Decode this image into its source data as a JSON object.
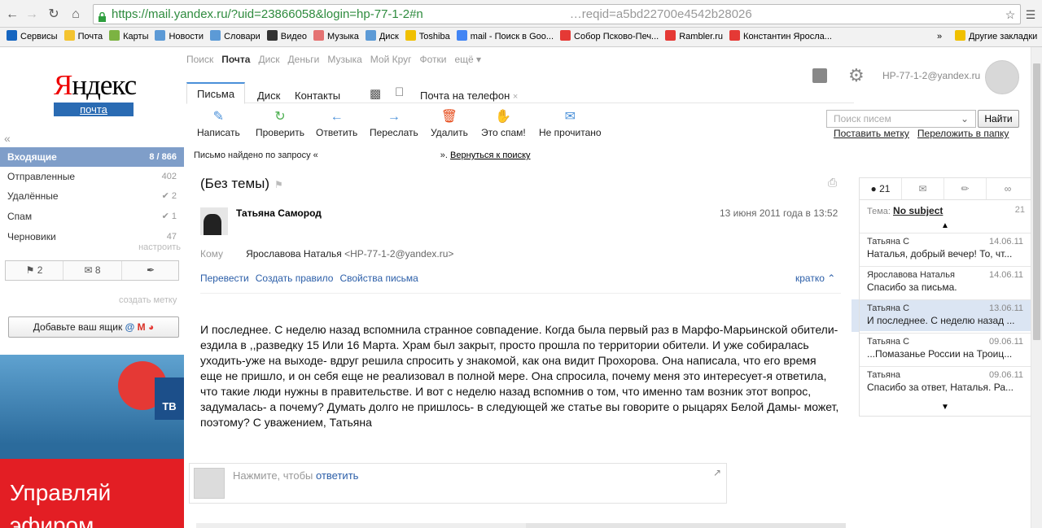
{
  "browser": {
    "url_text": "https://mail.yandex.ru/?uid=23866058&login=hp-77-1-2#n",
    "url_tail": "…reqid=a5bd22700e4542b28026",
    "bookmarks": [
      {
        "label": "Сервисы",
        "color": "#1565c0"
      },
      {
        "label": "Почта",
        "color": "#f4c430"
      },
      {
        "label": "Карты",
        "color": "#7cb342"
      },
      {
        "label": "Новости",
        "color": "#5c9ad6"
      },
      {
        "label": "Словари",
        "color": "#5c9ad6"
      },
      {
        "label": "Видео",
        "color": "#333333"
      },
      {
        "label": "Музыка",
        "color": "#e57373"
      },
      {
        "label": "Диск",
        "color": "#5c9ad6"
      },
      {
        "label": "Toshiba",
        "color": "#f0c000"
      },
      {
        "label": "mail - Поиск в Goo...",
        "color": "#4285f4"
      },
      {
        "label": "Собор Псково-Печ...",
        "color": "#e53935"
      },
      {
        "label": "Rambler.ru",
        "color": "#e53935"
      },
      {
        "label": "Константин Яросла...",
        "color": "#e53935"
      }
    ],
    "more": "»",
    "other_bookmarks": "Другие закладки"
  },
  "topnav": [
    "Поиск",
    "Почта",
    "Диск",
    "Деньги",
    "Музыка",
    "Мой Круг",
    "Фотки",
    "ещё ▾"
  ],
  "logo": {
    "ya_red": "Я",
    "ya_rest": "ндекс",
    "pochta": "почта"
  },
  "user_email": "HP-77-1-2@yandex.ru",
  "folders": [
    {
      "label": "Входящие",
      "count": "8 / 866"
    },
    {
      "label": "Отправленные",
      "count": "402"
    },
    {
      "label": "Удалённые",
      "count": "✔ 2"
    },
    {
      "label": "Спам",
      "count": "✔ 1"
    },
    {
      "label": "Черновики",
      "count": "47"
    }
  ],
  "setup_link": "настроить",
  "filters": {
    "flagged": "⚑ 2",
    "unread": "✉ 8",
    "attach": "✒"
  },
  "create_label": "создать метку",
  "add_box": "Добавьте ваш ящик",
  "ad": {
    "line1": "Управляй",
    "line2": "эфиром",
    "tv": "ТВ"
  },
  "tabs": {
    "letters": "Письма",
    "disk": "Диск",
    "contacts": "Контакты",
    "phone": "Почта на телефон",
    "phone_close": "×"
  },
  "toolbar": {
    "compose": "Написать",
    "check": "Проверить",
    "reply": "Ответить",
    "forward": "Переслать",
    "delete": "Удалить",
    "spam": "Это спам!",
    "unread": "Не прочитано"
  },
  "search": {
    "placeholder": "Поиск писем",
    "button": "Найти"
  },
  "tag_links": {
    "label": "Поставить метку",
    "move": "Переложить в папку"
  },
  "found": {
    "text": "Письмо найдено по запросу «",
    "tail": "».",
    "back": "Вернуться к поиску"
  },
  "message": {
    "subject": "(Без темы)",
    "sender": "Татьяна Самород",
    "date": "13 июня 2011 года в 13:52",
    "to_label": "Кому",
    "to_name": "Ярославова Наталья",
    "to_email": "<HP-77-1-2@yandex.ru>",
    "translate": "Перевести",
    "create_rule": "Создать правило",
    "props": "Свойства письма",
    "brief": "кратко ⌃",
    "body": "И последнее. С неделю назад вспомнила странное совпадение. Когда была первый раз в Марфо-Марьинской обители- ездила в ,,разведку 15 Или 16 Марта. Храм был закрыт, просто прошла по территории обители. И уже собиралась уходить-уже на выходе- вдруг решила спросить у знакомой, как она видит Прохорова. Она написала, что его время еще не пришло, и он себя еще не реализовал в полной мере. Она спросила, почему меня это интересует-я ответила, что такие люди нужны в правительстве.  И вот с неделю назад вспомнив о том, что именно там возник этот вопрос, задумалась- а почему? Думать долго не пришлось- в следующей же статье вы говорите о рыцарях Белой Дамы- может, поэтому?    С уважением, Татьяна"
  },
  "reply_box": {
    "placeholder": "Нажмите, чтобы",
    "action": "ответить"
  },
  "thread": {
    "count": "21",
    "subject_label": "Тема:",
    "subject": "No subject",
    "subject_count": "21",
    "items": [
      {
        "from": "Татьяна С",
        "date": "14.06.11",
        "preview": "Наталья, добрый вечер! То, чт..."
      },
      {
        "from": "Ярославова Наталья",
        "date": "14.06.11",
        "preview": "Спасибо за письма."
      },
      {
        "from": "Татьяна С",
        "date": "13.06.11",
        "preview": "И последнее. С неделю назад ..."
      },
      {
        "from": "Татьяна С",
        "date": "09.06.11",
        "preview": "...Помазанье России на Троиц..."
      },
      {
        "from": "Татьяна",
        "date": "09.06.11",
        "preview": "Спасибо за ответ, Наталья. Ра..."
      }
    ]
  }
}
